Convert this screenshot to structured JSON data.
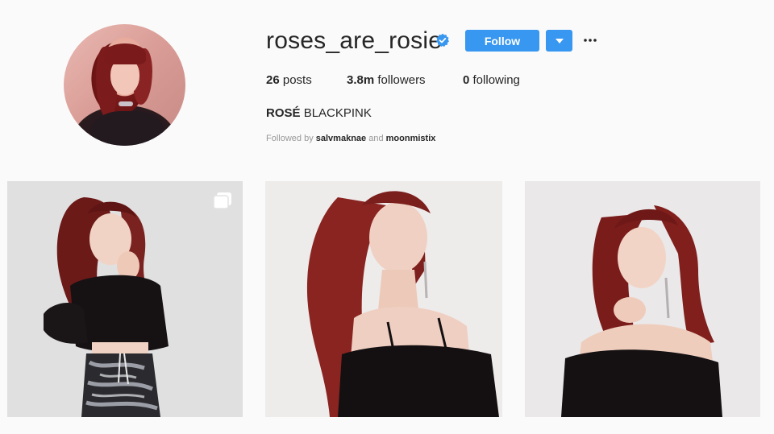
{
  "profile": {
    "username": "roses_are_rosie",
    "verified": true,
    "verified_icon": "verified-badge-icon",
    "follow_label": "Follow",
    "dropdown_icon": "caret-down-icon",
    "more_icon": "more-options-icon"
  },
  "stats": {
    "posts_count": "26",
    "posts_label": "posts",
    "followers_count": "3.8m",
    "followers_label": "followers",
    "following_count": "0",
    "following_label": "following"
  },
  "bio": {
    "name": "ROSÉ",
    "tagline": "BLACKPINK"
  },
  "followed_by": {
    "prefix": "Followed by",
    "user1": "salvmaknae",
    "conjunction": "and",
    "user2": "moonmistix"
  },
  "posts": [
    {
      "type": "carousel",
      "icon": "multiple-photos-icon"
    },
    {
      "type": "photo"
    },
    {
      "type": "photo"
    }
  ],
  "colors": {
    "accent": "#3897f0",
    "background": "#fafafa",
    "text": "#262626",
    "muted": "#999999"
  }
}
